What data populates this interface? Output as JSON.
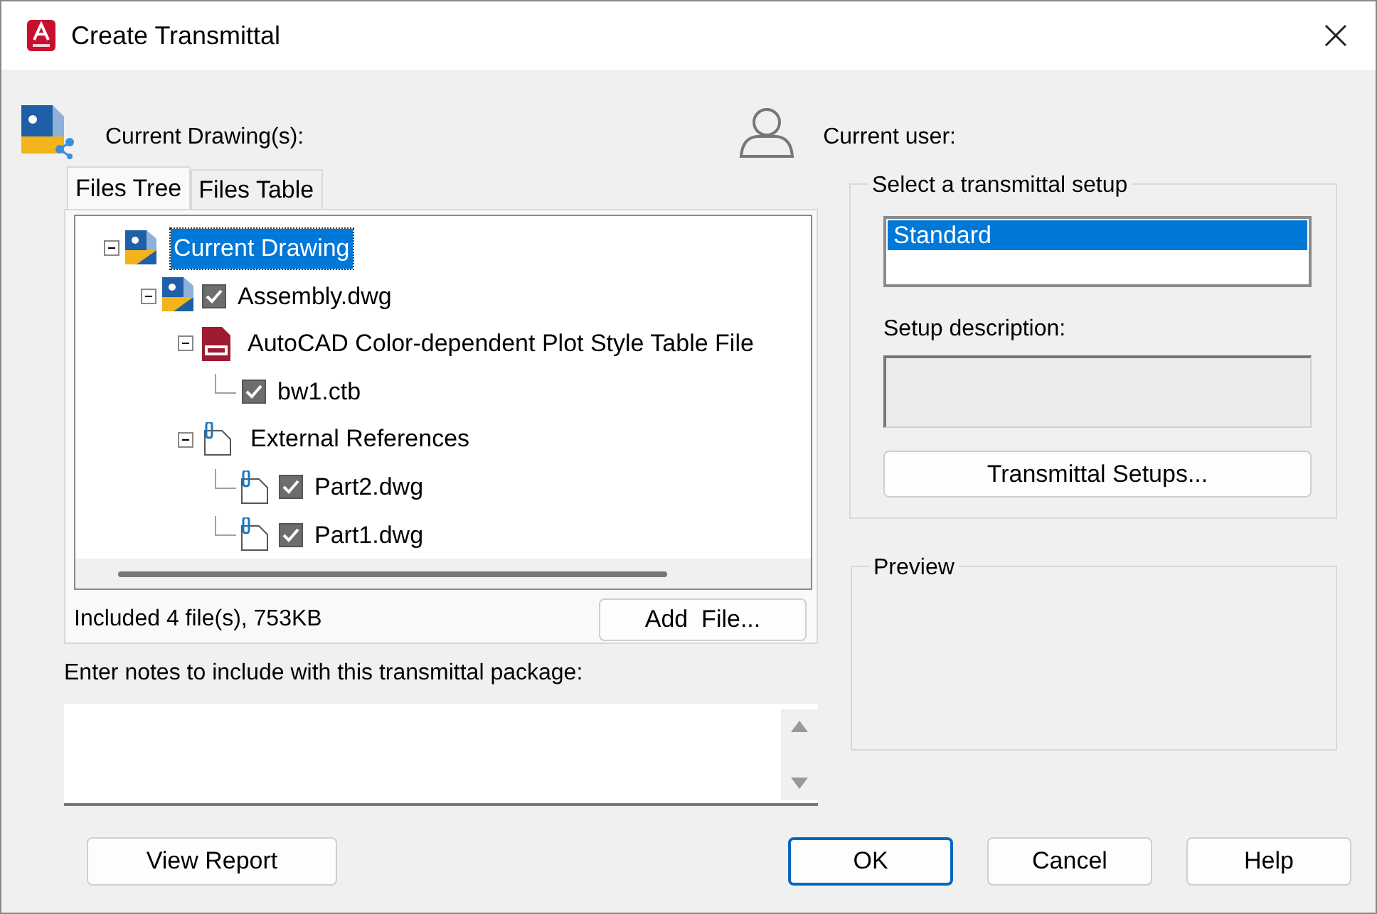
{
  "window": {
    "title": "Create Transmittal"
  },
  "current_drawings": {
    "label": "Current Drawing(s):"
  },
  "current_user": {
    "label": "Current user:"
  },
  "tabs": [
    {
      "label": "Files Tree",
      "selected": true
    },
    {
      "label": "Files Table",
      "selected": false
    }
  ],
  "tree": [
    {
      "label": "Current Drawing",
      "kind": "drawing",
      "selected": true,
      "expanded": true,
      "children": [
        {
          "label": "Assembly.dwg",
          "kind": "drawing",
          "checked": true,
          "selected": false,
          "expanded": true,
          "children": [
            {
              "label": "AutoCAD Color-dependent Plot Style Table File",
              "kind": "ctb",
              "selected": false,
              "expanded": true,
              "children": [
                {
                  "label": "bw1.ctb",
                  "checked": true,
                  "selected": false
                }
              ]
            },
            {
              "label": "External References",
              "kind": "xref",
              "selected": false,
              "expanded": true,
              "children": [
                {
                  "label": "Part2.dwg",
                  "kind": "xref",
                  "checked": true,
                  "selected": false
                },
                {
                  "label": "Part1.dwg",
                  "kind": "xref",
                  "checked": true,
                  "selected": false
                }
              ]
            }
          ]
        }
      ]
    }
  ],
  "summary": "Included 4 file(s), 753KB",
  "add_file_button": "Add  File...",
  "notes": {
    "label": "Enter notes to include with this transmittal package:"
  },
  "setup_group": {
    "title": "Select a transmittal setup",
    "setups": [
      {
        "label": "Standard",
        "selected": true
      }
    ],
    "description_label": "Setup description:",
    "setups_button": "Transmittal Setups..."
  },
  "preview": {
    "title": "Preview"
  },
  "view_report_button": "View Report",
  "buttons": [
    {
      "label": "OK",
      "default": true
    },
    {
      "label": "Cancel",
      "default": false
    },
    {
      "label": "Help",
      "default": false
    }
  ]
}
